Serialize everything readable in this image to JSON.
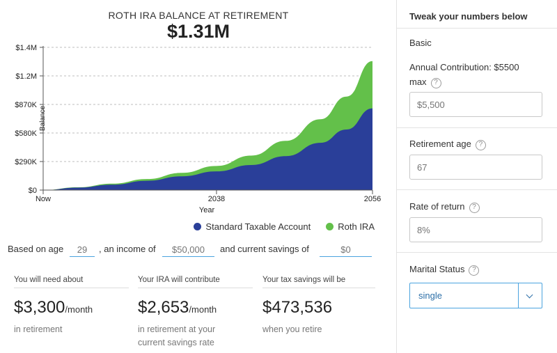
{
  "header": {
    "title": "ROTH IRA BALANCE AT RETIREMENT",
    "value": "$1.31M"
  },
  "chart_data": {
    "type": "area",
    "xlabel": "Year",
    "ylabel": "Balance",
    "x_ticks": [
      "Now",
      "2038",
      "2056"
    ],
    "y_ticks": [
      "$0",
      "$290K",
      "$580K",
      "$870K",
      "$1.2M",
      "$1.4M"
    ],
    "y_tick_values": [
      0,
      290000,
      580000,
      870000,
      1160000,
      1450000
    ],
    "ylim": [
      0,
      1450000
    ],
    "x": [
      2018,
      2022,
      2026,
      2030,
      2034,
      2038,
      2042,
      2046,
      2050,
      2053,
      2056
    ],
    "series": [
      {
        "name": "Standard Taxable Account",
        "color": "#2a3f99",
        "values": [
          0,
          25000,
          55000,
          95000,
          140000,
          190000,
          255000,
          345000,
          480000,
          615000,
          830000
        ]
      },
      {
        "name": "Roth IRA",
        "color": "#63c04a",
        "values": [
          0,
          28000,
          65000,
          112000,
          175000,
          245000,
          350000,
          500000,
          720000,
          950000,
          1310000
        ]
      }
    ],
    "grid": true,
    "legend": "bottom-right"
  },
  "legend": {
    "standard": "Standard Taxable Account",
    "roth": "Roth IRA",
    "standard_color": "#2a3f99",
    "roth_color": "#63c04a"
  },
  "sentence": {
    "part1": "Based on age",
    "age": "29",
    "part2": ", an income of",
    "income": "$50,000",
    "part3": "and current savings of",
    "savings": "$0"
  },
  "stats": [
    {
      "label": "You will need about",
      "value": "$3,300",
      "unit": "/month",
      "sub": "in retirement"
    },
    {
      "label": "Your IRA will contribute",
      "value": "$2,653",
      "unit": "/month",
      "sub": "in retirement at your current savings rate"
    },
    {
      "label": "Your tax savings will be",
      "value": "$473,536",
      "unit": "",
      "sub": "when you retire"
    }
  ],
  "panel": {
    "title": "Tweak your numbers below",
    "section": "Basic",
    "contribution_label": "Annual Contribution: $5500 max",
    "contribution_value": "$5,500",
    "retirement_label": "Retirement age",
    "retirement_value": "67",
    "return_label": "Rate of return",
    "return_value": "8%",
    "marital_label": "Marital Status",
    "marital_value": "single",
    "help_icon": "?"
  }
}
